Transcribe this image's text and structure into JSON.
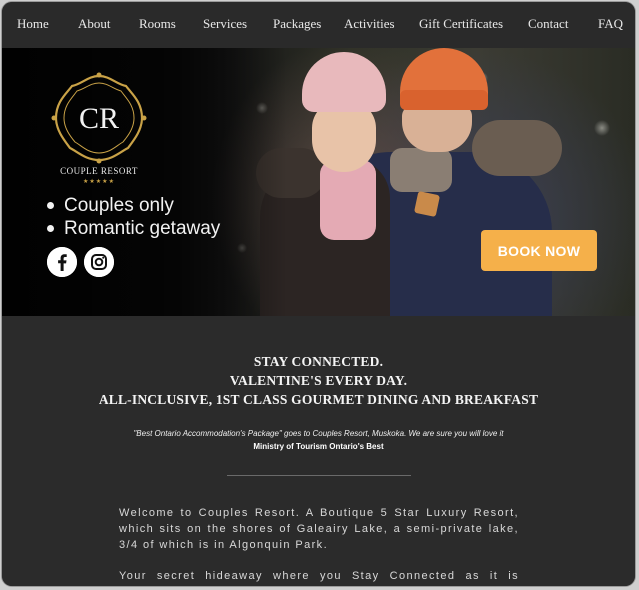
{
  "nav": {
    "items": [
      "Home",
      "About",
      "Rooms",
      "Services",
      "Packages",
      "Activities",
      "Gift Certificates",
      "Contact",
      "FAQ"
    ]
  },
  "hero": {
    "logo": {
      "monogram": "CR",
      "name": "COUPLE RESORT",
      "stars": "★★★★★"
    },
    "bullets": [
      "Couples only",
      "Romantic getaway"
    ],
    "social": [
      "facebook-icon",
      "instagram-icon"
    ],
    "book_label": "BOOK NOW"
  },
  "content": {
    "headlines": [
      "STAY CONNECTED.",
      "VALENTINE'S EVERY DAY.",
      "ALL-INCLUSIVE, 1ST CLASS GOURMET DINING AND BREAKFAST"
    ],
    "quote": "\"Best Ontario Accommodation's Package\" goes to Couples Resort, Muskoka. We are sure you will love it",
    "ministry": "Ministry of Tourism Ontario's Best",
    "paragraph1": "Welcome to Couples Resort. A Boutique 5 Star Luxury Resort, which sits on the shores of  Galeairy Lake, a semi-private lake, 3/4 of which is in Algonquin Park.",
    "paragraph2": "Your secret hideaway where you Stay Connected as it is Valentine's Every Day!. Whether you need to reconnect or need"
  },
  "colors": {
    "accent": "#f5b04a",
    "gold": "#c9a247",
    "background": "#2b2b2b"
  }
}
